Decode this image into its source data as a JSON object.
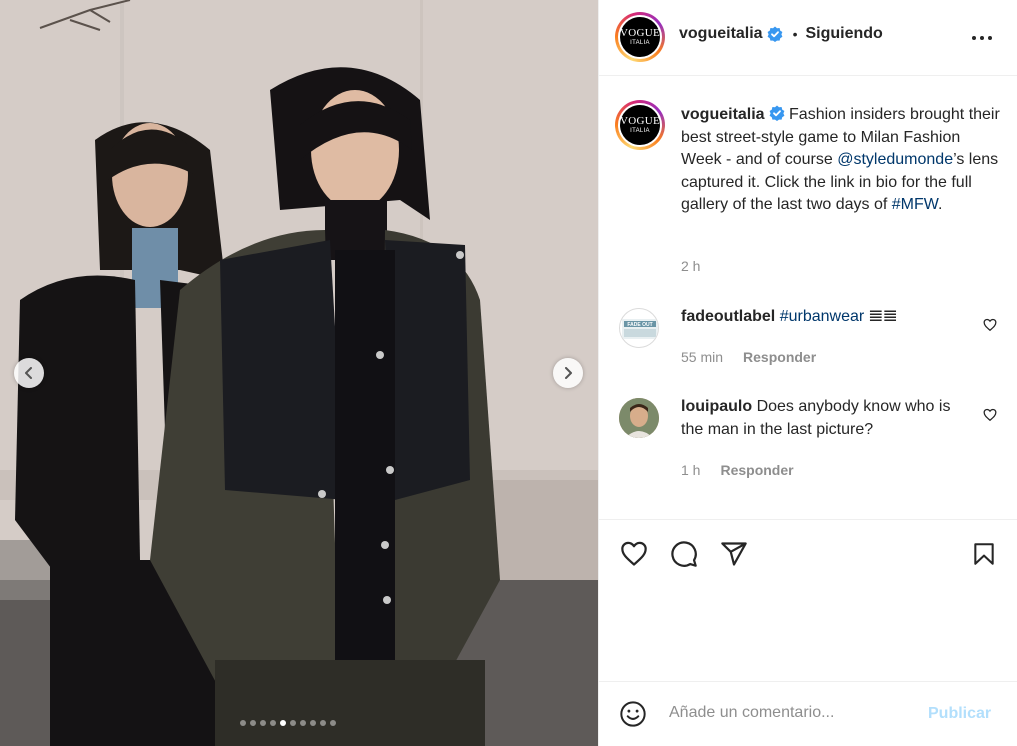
{
  "post": {
    "username": "vogueitalia",
    "avatar_logo_line1": "VOGUE",
    "avatar_logo_line2": "ITALIA",
    "follow_status": "Siguiendo",
    "caption_text": "Fashion insiders brought their best street-style game to Milan Fashion Week - and of course",
    "caption_mention": "@styledumonde",
    "caption_mid": "’s lens captured it. Click the link in bio for the full gallery of the last two days of",
    "caption_hashtag": "#MFW",
    "caption_end": ".",
    "time": "2 h"
  },
  "carousel": {
    "slide_count": 10,
    "active_index": 4
  },
  "comments": [
    {
      "username": "fadeoutlabel",
      "text": "#urbanwear",
      "emoji": "𝌆𝌆",
      "time": "55 min",
      "reply_label": "Responder",
      "avatar_text": "FADE OUT"
    },
    {
      "username": "louipaulo",
      "text": "Does anybody know who is the man in the last picture?",
      "time": "1 h",
      "reply_label": "Responder"
    }
  ],
  "add_comment": {
    "placeholder": "Añade un comentario...",
    "publish_label": "Publicar"
  },
  "colors": {
    "link": "#00376b",
    "verified": "#3897f0",
    "publish_disabled": "#b2dffc",
    "muted": "#8e8e8e"
  },
  "icons": [
    "chevron-left-icon",
    "chevron-right-icon",
    "verified-badge-icon",
    "more-options-icon",
    "heart-icon",
    "comment-icon",
    "share-icon",
    "bookmark-icon",
    "emoji-icon"
  ]
}
